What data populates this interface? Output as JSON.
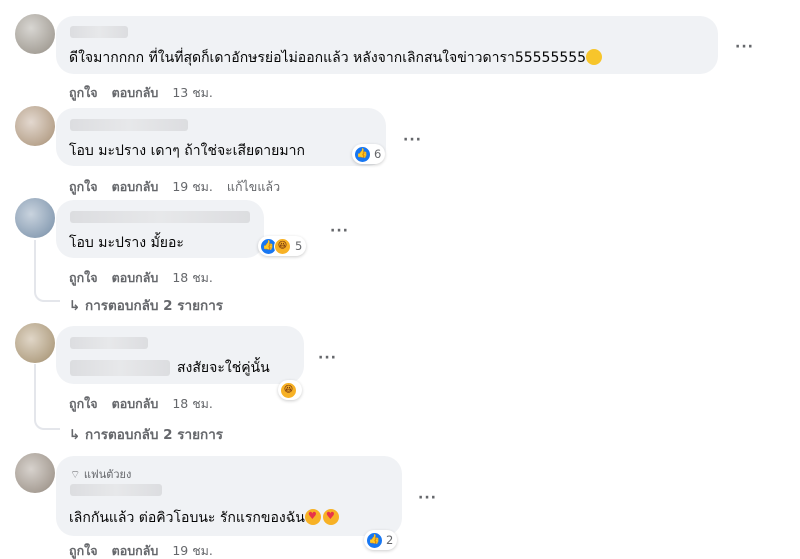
{
  "actions": {
    "like": "ถูกใจ",
    "reply": "ตอบกลับ",
    "edited": "แก้ไขแล้ว"
  },
  "comments": [
    {
      "text": "ดีใจมากกกก ที่ในที่สุดก็เดาอักษรย่อไม่ออกแล้ว หลังจากเลิกสนใจข่าวดารา55555555",
      "time": "13 ชม."
    },
    {
      "text": "โอบ มะปราง เดาๆ ถ้าใช่จะเสียดายมาก",
      "time": "19 ชม.",
      "reaction_count": "6"
    },
    {
      "text": "โอบ มะปราง มั้ยอะ",
      "time": "18 ชม.",
      "reaction_count": "5",
      "replies": "การตอบกลับ 2 รายการ"
    },
    {
      "text": "สงสัยจะใช่คู่นั้น",
      "time": "18 ชม.",
      "replies": "การตอบกลับ 2 รายการ"
    },
    {
      "badge": "แฟนตัวยง",
      "text": "เลิกกันแล้ว ต่อคิวโอบนะ รักแรกของฉัน",
      "time": "19 ชม.",
      "reaction_count": "2"
    }
  ],
  "icons": {
    "more": "more-options-icon",
    "reply_arrow": "reply-arrow-icon",
    "like": "like-icon",
    "haha": "haha-icon",
    "diamond": "diamond-icon"
  }
}
